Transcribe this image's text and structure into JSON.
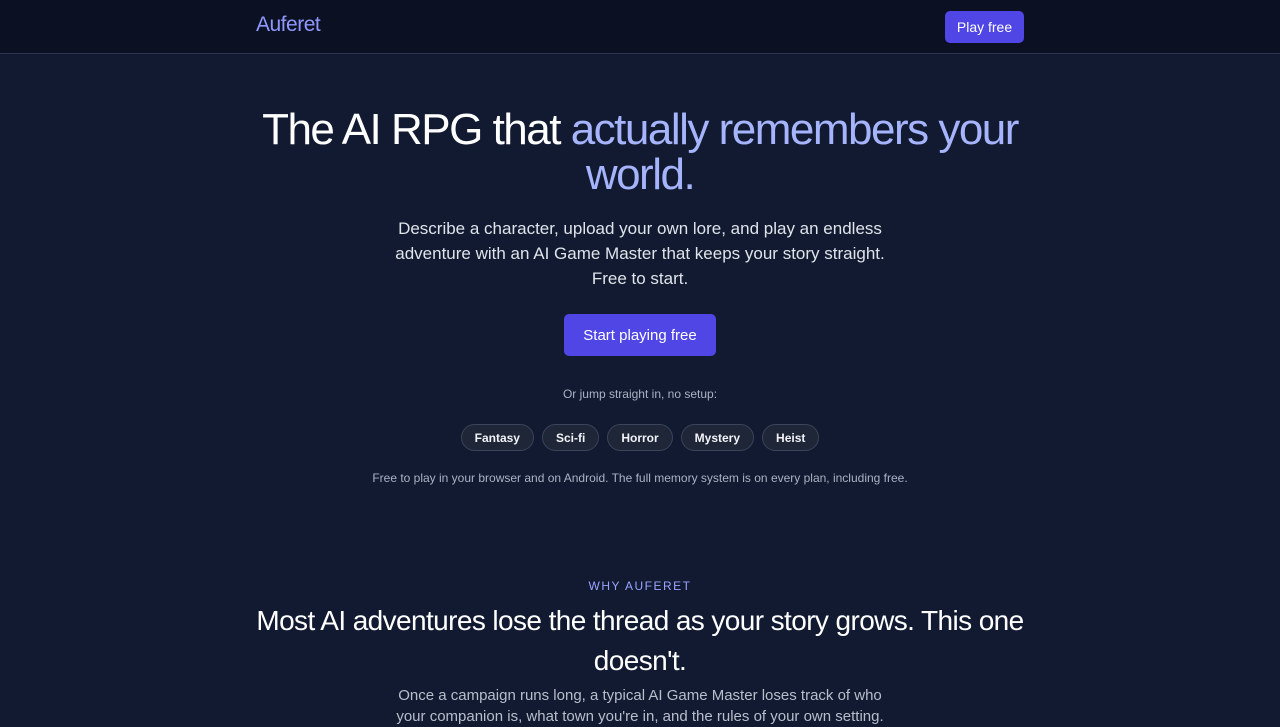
{
  "nav": {
    "logo": "Auferet",
    "cta_label": "Play free"
  },
  "hero": {
    "title_plain": "The AI RPG that ",
    "title_accent": "actually remembers your world.",
    "subtitle": "Describe a character, upload your own lore, and play an endless adventure with an AI Game Master that keeps your story straight. Free to start.",
    "cta_label": "Start playing free",
    "jump_label": "Or jump straight in, no setup:",
    "genres": [
      "Fantasy",
      "Sci-fi",
      "Horror",
      "Mystery",
      "Heist"
    ],
    "note": "Free to play in your browser and on Android. The full memory system is on every plan, including free."
  },
  "why": {
    "eyebrow": "WHY AUFERET",
    "title": "Most AI adventures lose the thread as your story grows. This one doesn't.",
    "body": "Once a campaign runs long, a typical AI Game Master loses track of who your companion is, what town you're in, and the rules of your own setting."
  },
  "colors": {
    "background": "#111a30",
    "topbar": "#0b1122",
    "accent": "#4f46e5",
    "accent_text": "#a5b4fc"
  }
}
